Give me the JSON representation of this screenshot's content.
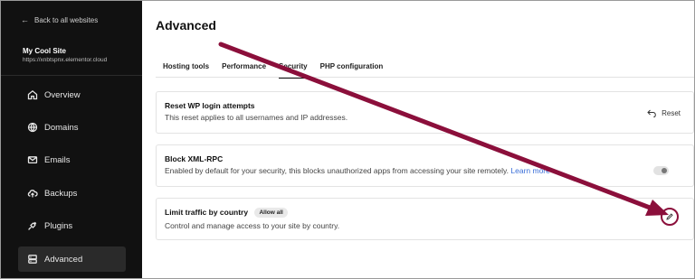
{
  "sidebar": {
    "back_label": "Back to all websites",
    "site_name": "My Cool Site",
    "site_url": "https://xnbtspnx.elementor.cloud",
    "items": [
      {
        "label": "Overview",
        "icon": "home-icon"
      },
      {
        "label": "Domains",
        "icon": "globe-icon"
      },
      {
        "label": "Emails",
        "icon": "mail-icon"
      },
      {
        "label": "Backups",
        "icon": "cloud-upload-icon"
      },
      {
        "label": "Plugins",
        "icon": "plug-icon"
      },
      {
        "label": "Advanced",
        "icon": "server-icon",
        "active": true
      }
    ]
  },
  "main": {
    "title": "Advanced",
    "tabs": [
      {
        "label": "Hosting tools"
      },
      {
        "label": "Performance"
      },
      {
        "label": "Security",
        "active": true
      },
      {
        "label": "PHP configuration"
      }
    ],
    "cards": [
      {
        "title": "Reset WP login attempts",
        "description": "This reset applies to all usernames and IP addresses.",
        "action_label": "Reset"
      },
      {
        "title": "Block XML-RPC",
        "description": "Enabled by default for your security, this blocks unauthorized apps from accessing your site remotely.",
        "link_label": "Learn more",
        "toggle_on": false
      },
      {
        "title": "Limit traffic by country",
        "badge": "Allow all",
        "description": "Control and manage access to your site by country.",
        "action_icon": "pencil-icon"
      }
    ]
  },
  "colors": {
    "sidebar_bg": "#111111",
    "annotation": "#8b0f3b",
    "link": "#3b6fd8"
  }
}
